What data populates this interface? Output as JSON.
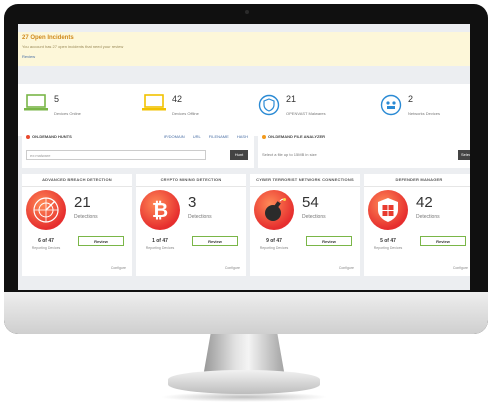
{
  "banner": {
    "title": "27 Open Incidents",
    "subtitle": "You account has 27 open incidents that need your review",
    "link": "Review"
  },
  "stats": [
    {
      "number": "5",
      "label": "Devices Online",
      "icon": "laptop-icon",
      "color": "#7ab648"
    },
    {
      "number": "42",
      "label": "Devices Offline",
      "icon": "laptop-icon",
      "color": "#f2c200"
    },
    {
      "number": "21",
      "label": "OPENVAST Malwares",
      "icon": "shield-icon",
      "color": "#2a8ad4"
    },
    {
      "number": "2",
      "label": "Networks Devices",
      "icon": "network-icon",
      "color": "#2a8ad4"
    }
  ],
  "hunts": {
    "title": "ON-DEMAND HUNTS",
    "tabs": [
      "IP/DOMAIN",
      "URL",
      "FILENAME",
      "HASH"
    ],
    "placeholder": "ex:malware",
    "button": "Hunt"
  },
  "analyzer": {
    "title": "ON-DEMAND FILE ANALYZER",
    "subtitle": "Select a file up to 15MB in size",
    "button": "Select"
  },
  "cards": [
    {
      "title": "ADVANCED BREACH DETECTION",
      "number": "21",
      "detections": "Detections",
      "ratio": "6 of 47",
      "reporting": "Reporting Devices",
      "button": "Review",
      "config": "Configure",
      "icon": "radar-icon"
    },
    {
      "title": "CRYPTO MINING DETECTION",
      "number": "3",
      "detections": "Detections",
      "ratio": "1 of 47",
      "reporting": "Reporting Devices",
      "button": "Review",
      "config": "Configure",
      "icon": "bitcoin-icon"
    },
    {
      "title": "CYBER TERRORIST NETWORK CONNECTIONS",
      "number": "54",
      "detections": "Detections",
      "ratio": "9 of 47",
      "reporting": "Reporting Devices",
      "button": "Review",
      "config": "Configure",
      "icon": "bomb-icon"
    },
    {
      "title": "DEFENDER MANAGER",
      "number": "42",
      "detections": "Detections",
      "ratio": "5 of 47",
      "reporting": "Reporting Devices",
      "button": "Review",
      "config": "Configure",
      "icon": "windows-shield-icon"
    }
  ]
}
